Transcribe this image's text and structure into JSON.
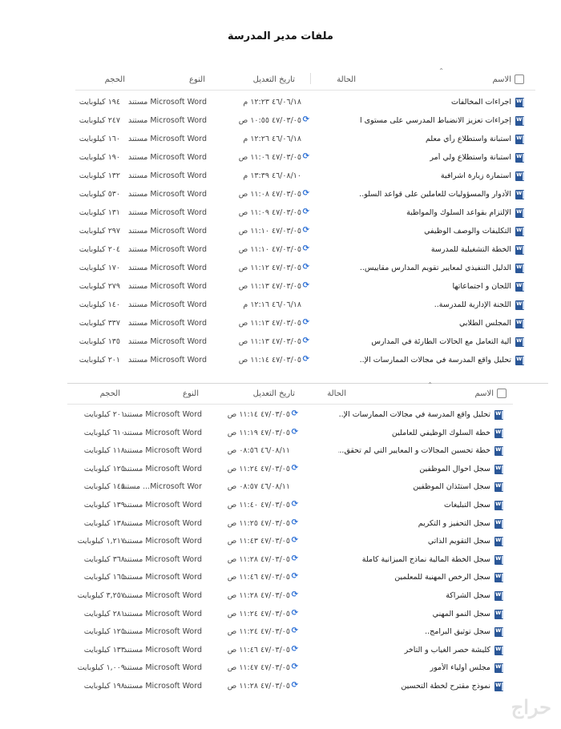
{
  "title": "ملفات مدير المدرسة",
  "columns": {
    "name": "الاسم",
    "status": "الحالة",
    "modified": "تاريخ التعديل",
    "type": "النوع",
    "size": "الحجم"
  },
  "panel1": {
    "rows": [
      {
        "name": "اجراءات المخالفات",
        "status": "",
        "date": "٤٦/٠٦/١٨ ١٢:٢٣ م",
        "type": "Microsoft Word مستند",
        "size": "١٩٤ كيلوبايت"
      },
      {
        "name": "إجراءات تعزيز الانضباط المدرسي على مستوى ا...",
        "status": "sync",
        "date": "٤٧/٠٣/٠٥ ١٠:٥٥ ص",
        "type": "Microsoft Word مستند",
        "size": "٢٤٧ كيلوبايت"
      },
      {
        "name": "استبانة واستطلاع رأي معلم",
        "status": "",
        "date": "٤٦/٠٦/١٨ ١٢:٢٦ م",
        "type": "Microsoft Word مستند",
        "size": "١٦٠ كيلوبايت"
      },
      {
        "name": "استبانة واستطلاع ولي أمر",
        "status": "sync",
        "date": "٤٧/٠٣/٠٥ ١١:٠٦ ص",
        "type": "Microsoft Word مستند",
        "size": "١٩٠ كيلوبايت"
      },
      {
        "name": "استمارة زيارة اشرافية",
        "status": "",
        "date": "٤٦/٠٨/١٠ ١٣:٣٩ م",
        "type": "Microsoft Word مستند",
        "size": "١٣٢ كيلوبايت"
      },
      {
        "name": "الأدوار والمسؤوليات للعاملين على قواعد السلو...",
        "status": "sync",
        "date": "٤٧/٠٣/٠٥ ١١:٠٨ ص",
        "type": "Microsoft Word مستند",
        "size": "٥٣٠ كيلوبايت"
      },
      {
        "name": "الإلتزام بقواعد السلوك والمواظبة",
        "status": "sync",
        "date": "٤٧/٠٣/٠٥ ١١:٠٩ ص",
        "type": "Microsoft Word مستند",
        "size": "١٣١ كيلوبايت"
      },
      {
        "name": "التكليفات والوصف الوظيفي",
        "status": "sync",
        "date": "٤٧/٠٣/٠٥ ١١:١٠ ص",
        "type": "Microsoft Word مستند",
        "size": "٢٩٧ كيلوبايت"
      },
      {
        "name": "الخطة التشغيلية للمدرسة",
        "status": "sync",
        "date": "٤٧/٠٣/٠٥ ١١:١٠ ص",
        "type": "Microsoft Word مستند",
        "size": "٢٠٤ كيلوبايت"
      },
      {
        "name": "الدليل التنفيذي لمعايير تقويم المدارس مقاييس...",
        "status": "sync",
        "date": "٤٧/٠٣/٠٥ ١١:١٢ ص",
        "type": "Microsoft Word مستند",
        "size": "١٧٠ كيلوبايت"
      },
      {
        "name": "اللجان و اجتماعاتها",
        "status": "sync",
        "date": "٤٧/٠٣/٠٥ ١١:١٣ ص",
        "type": "Microsoft Word مستند",
        "size": "٢٧٩ كيلوبايت"
      },
      {
        "name": "اللجنة الإدارية للمدرسة..",
        "status": "",
        "date": "٤٦/٠٦/١٨ ١٢:١٦ م",
        "type": "Microsoft Word مستند",
        "size": "١٤٠ كيلوبايت"
      },
      {
        "name": "المجلس الطلابي",
        "status": "sync",
        "date": "٤٧/٠٣/٠٥ ١١:١٣ ص",
        "type": "Microsoft Word مستند",
        "size": "٣٣٧ كيلوبايت"
      },
      {
        "name": "ألية التعامل مع الحالات الطارئة في المدارس",
        "status": "sync",
        "date": "٤٧/٠٣/٠٥ ١١:١٣ ص",
        "type": "Microsoft Word مستند",
        "size": "١٣٥ كيلوبايت"
      },
      {
        "name": "تحليل واقع المدرسة في مجالات الممارسات الإ...",
        "status": "sync",
        "date": "٤٧/٠٣/٠٥ ١١:١٤ ص",
        "type": "Microsoft Word مستند",
        "size": "٢٠١ كيلوبايت"
      }
    ]
  },
  "panel2": {
    "rows": [
      {
        "name": "تحليل واقع المدرسة في مجالات الممارسات الإ...",
        "status": "sync",
        "date": "٤٧/٠٣/٠٥ ١١:١٤ ص",
        "type": "Microsoft Word مستند",
        "size": "٢٠١ كيلوبايت"
      },
      {
        "name": "خطة السلوك الوظيفي للعاملين",
        "status": "sync",
        "date": "٤٧/٠٣/٠٥ ١١:١٩ ص",
        "type": "Microsoft Word مستند",
        "size": "٦١٠ كيلوبايت"
      },
      {
        "name": "خطة تحسين المجالات و المعايير التي لم تحقق...",
        "status": "",
        "date": "٤٦/٠٨/١١ ٠٨:٥٦ ص",
        "type": "Microsoft Word مستند",
        "size": "١١٨ كيلوبايت"
      },
      {
        "name": "سجل احوال الموظفين",
        "status": "sync",
        "date": "٤٧/٠٣/٠٥ ١١:٢٤ ص",
        "type": "Microsoft Word مستند",
        "size": "١٢٥ كيلوبايت"
      },
      {
        "name": "سجل استئذان الموظفين",
        "status": "",
        "date": "٤٦/٠٨/١١ ٠٨:٥٧ ص",
        "type": "Microsoft Wor... مستند",
        "size": "١٤٥ كيلوبايت"
      },
      {
        "name": "سجل التبليغات",
        "status": "sync",
        "date": "٤٧/٠٣/٠٥ ١١:٤٠ ص",
        "type": "Microsoft Word مستند",
        "size": "١٣٩ كيلوبايت"
      },
      {
        "name": "سجل التحفيز و التكريم",
        "status": "sync",
        "date": "٤٧/٠٣/٠٥ ١١:٢٥ ص",
        "type": "Microsoft Word مستند",
        "size": "١٣٨ كيلوبايت"
      },
      {
        "name": "سجل التقويم الذاتي",
        "status": "sync",
        "date": "٤٧/٠٣/٠٥ ١١:٤٣ ص",
        "type": "Microsoft Word مستند",
        "size": "١,٢١٧ كيلوبايت"
      },
      {
        "name": "سجل الخطة المالية نماذج الميزانية كاملة",
        "status": "sync",
        "date": "٤٧/٠٣/٠٥ ١١:٢٨ ص",
        "type": "Microsoft Word مستند",
        "size": "٣٦٨ كيلوبايت"
      },
      {
        "name": "سجل الرخص المهنية للمعلمين",
        "status": "sync",
        "date": "٤٧/٠٣/٠٥ ١١:٤٦ ص",
        "type": "Microsoft Word مستند",
        "size": "١٦٥ كيلوبايت"
      },
      {
        "name": "سجل الشراكة",
        "status": "sync",
        "date": "٤٧/٠٣/٠٥ ١١:٢٨ ص",
        "type": "Microsoft Word مستند",
        "size": "٣,٢٥٧ كيلوبايت"
      },
      {
        "name": "سجل النمو المهني",
        "status": "sync",
        "date": "٤٧/٠٣/٠٥ ١١:٢٤ ص",
        "type": "Microsoft Word مستند",
        "size": "٢٨١ كيلوبايت"
      },
      {
        "name": "سجل توثيق البرامج..",
        "status": "sync",
        "date": "٤٧/٠٣/٠٥ ١١:٢٤ ص",
        "type": "Microsoft Word مستند",
        "size": "١٢٥ كيلوبايت"
      },
      {
        "name": "كليشة حصر الغياب و التأخر",
        "status": "sync",
        "date": "٤٧/٠٣/٠٥ ١١:٤٦ ص",
        "type": "Microsoft Word مستند",
        "size": "١٣٣ كيلوبايت"
      },
      {
        "name": "مجلس أولياء الأمور",
        "status": "sync",
        "date": "٤٧/٠٣/٠٥ ١١:٤٧ ص",
        "type": "Microsoft Word مستند",
        "size": "١,٠٠٩ كيلوبايت"
      },
      {
        "name": "نموذج مقترح لخطة التحسين",
        "status": "sync",
        "date": "٤٧/٠٣/٠٥ ١١:٢٨ ص",
        "type": "Microsoft Word مستند",
        "size": "١٩٨ كيلوبايت"
      }
    ]
  },
  "icons": {
    "file": "word-doc-icon",
    "sync": "sync-icon",
    "checkbox": "select-all-checkbox"
  },
  "colors": {
    "word": "#2b5797",
    "sync": "#2b6fd6"
  },
  "watermark": "حراج"
}
